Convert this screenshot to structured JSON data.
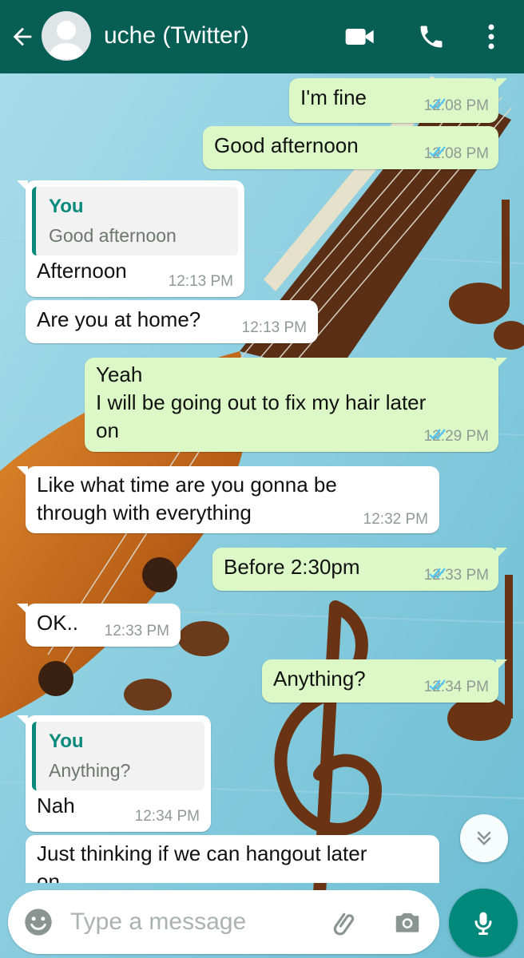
{
  "header": {
    "contact_name": "uche (Twitter)"
  },
  "icons": {
    "back": "arrow-left",
    "avatar": "default-person",
    "video_call": "videocam",
    "voice_call": "phone",
    "menu": "more-vertical",
    "scroll_down": "double-chevron-down",
    "emoji": "smiley",
    "attach": "paperclip",
    "camera": "camera",
    "mic": "microphone"
  },
  "colors": {
    "header": "#075e54",
    "outgoing_bubble": "#dcf8c6",
    "incoming_bubble": "#ffffff",
    "read_ticks": "#4fc3f7",
    "quote_accent": "#07897b",
    "mic_button": "#00897b"
  },
  "messages": [
    {
      "direction": "out",
      "text": "I'm fine",
      "time": "12:08 PM",
      "status": "read"
    },
    {
      "direction": "out",
      "text": "Good afternoon",
      "time": "12:08 PM",
      "status": "read"
    },
    {
      "direction": "in",
      "quote_sender": "You",
      "quote_text": "Good afternoon",
      "text": "Afternoon",
      "time": "12:13 PM"
    },
    {
      "direction": "in",
      "text": "Are you at home?",
      "time": "12:13 PM"
    },
    {
      "direction": "out",
      "text": "Yeah\nI will be going out to fix my hair later\non",
      "time": "12:29 PM",
      "status": "read"
    },
    {
      "direction": "in",
      "text": "Like what time are you gonna be\nthrough with everything",
      "time": "12:32 PM"
    },
    {
      "direction": "out",
      "text": "Before 2:30pm",
      "time": "12:33 PM",
      "status": "read"
    },
    {
      "direction": "in",
      "text": "OK..",
      "time": "12:33 PM"
    },
    {
      "direction": "out",
      "text": "Anything?",
      "time": "12:34 PM",
      "status": "read"
    },
    {
      "direction": "in",
      "quote_sender": "You",
      "quote_text": "Anything?",
      "text": "Nah",
      "time": "12:34 PM"
    },
    {
      "direction": "in",
      "text": "Just thinking if we can hangout later\non",
      "time": ""
    }
  ],
  "composer": {
    "placeholder": "Type a message"
  }
}
